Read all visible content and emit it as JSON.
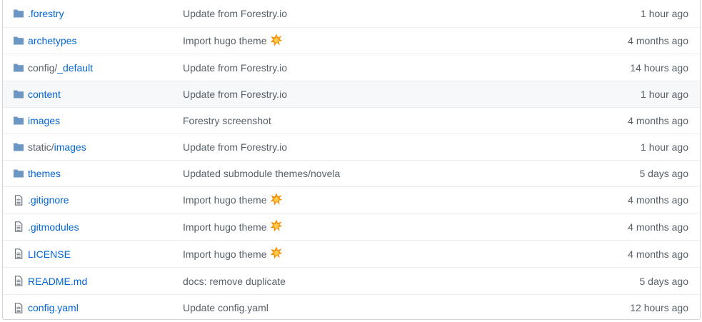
{
  "colors": {
    "link": "#0366d6",
    "muted": "#586069",
    "folder": "#79b8ff",
    "file": "#6a737d",
    "border": "#eaecef",
    "hover": "#f6f8fa"
  },
  "rows": [
    {
      "kind": "folder",
      "prefix": "",
      "name": ".forestry",
      "message": "Update from Forestry.io",
      "emoji": "",
      "age": "1 hour ago"
    },
    {
      "kind": "folder",
      "prefix": "",
      "name": "archetypes",
      "message": "Import hugo theme",
      "emoji": "collision-emoji",
      "age": "4 months ago"
    },
    {
      "kind": "folder",
      "prefix": "config/",
      "name": "_default",
      "message": "Update from Forestry.io",
      "emoji": "",
      "age": "14 hours ago"
    },
    {
      "kind": "folder",
      "prefix": "",
      "name": "content",
      "message": "Update from Forestry.io",
      "emoji": "",
      "age": "1 hour ago"
    },
    {
      "kind": "folder",
      "prefix": "",
      "name": "images",
      "message": "Forestry screenshot",
      "emoji": "",
      "age": "4 months ago"
    },
    {
      "kind": "folder",
      "prefix": "static/",
      "name": "images",
      "message": "Update from Forestry.io",
      "emoji": "",
      "age": "1 hour ago"
    },
    {
      "kind": "folder",
      "prefix": "",
      "name": "themes",
      "message": "Updated submodule themes/novela",
      "emoji": "",
      "age": "5 days ago"
    },
    {
      "kind": "file",
      "prefix": "",
      "name": ".gitignore",
      "message": "Import hugo theme",
      "emoji": "collision-emoji",
      "age": "4 months ago"
    },
    {
      "kind": "file",
      "prefix": "",
      "name": ".gitmodules",
      "message": "Import hugo theme",
      "emoji": "collision-emoji",
      "age": "4 months ago"
    },
    {
      "kind": "file",
      "prefix": "",
      "name": "LICENSE",
      "message": "Import hugo theme",
      "emoji": "collision-emoji",
      "age": "4 months ago"
    },
    {
      "kind": "file",
      "prefix": "",
      "name": "README.md",
      "message": "docs: remove duplicate",
      "emoji": "",
      "age": "5 days ago"
    },
    {
      "kind": "file",
      "prefix": "",
      "name": "config.yaml",
      "message": "Update config.yaml",
      "emoji": "",
      "age": "12 hours ago"
    }
  ]
}
